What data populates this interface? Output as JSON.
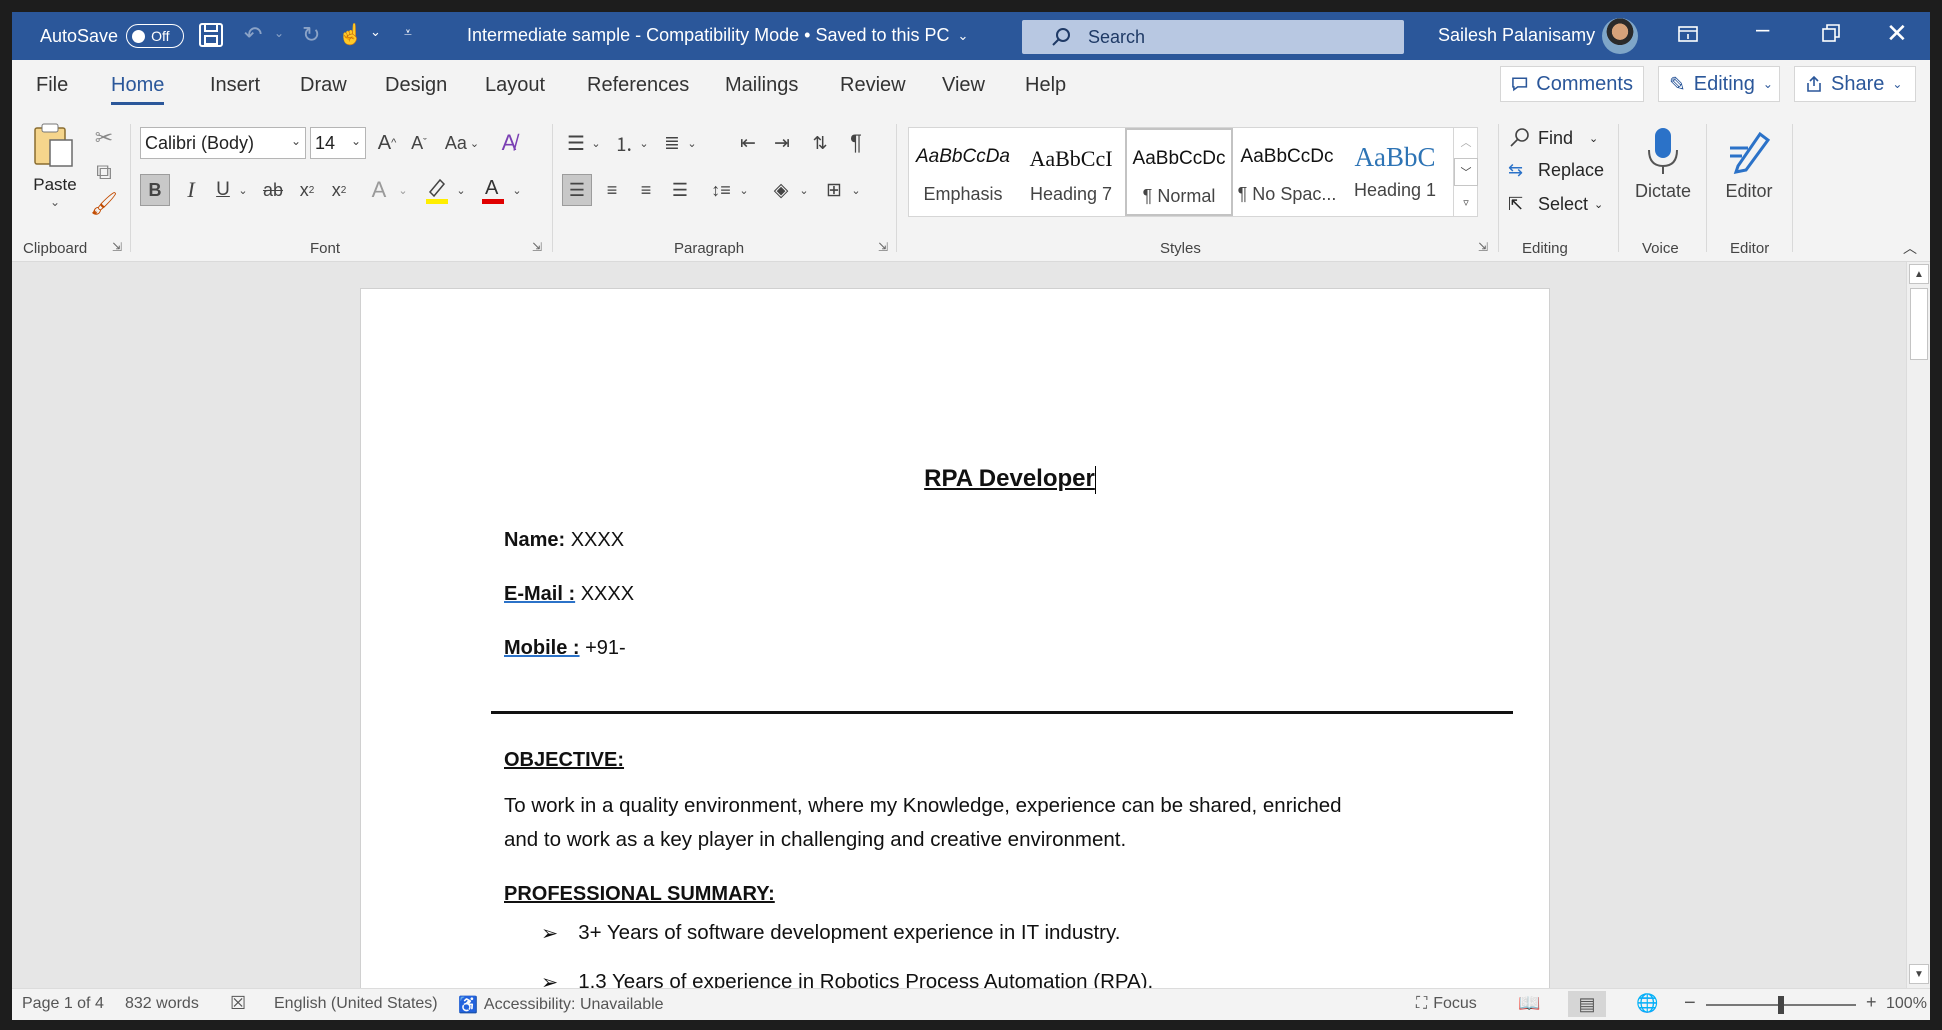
{
  "titlebar": {
    "autosave_label": "AutoSave",
    "autosave_state": "Off",
    "doc_title": "Intermediate sample  -  Compatibility Mode • Saved to this PC",
    "search_placeholder": "Search",
    "user_name": "Sailesh Palanisamy"
  },
  "menu": {
    "tabs": [
      "File",
      "Home",
      "Insert",
      "Draw",
      "Design",
      "Layout",
      "References",
      "Mailings",
      "Review",
      "View",
      "Help"
    ],
    "active_tab": "Home",
    "comments_label": "Comments",
    "editing_label": "Editing",
    "share_label": "Share"
  },
  "ribbon": {
    "clipboard": {
      "paste_label": "Paste",
      "group_label": "Clipboard"
    },
    "font": {
      "font_name": "Calibri (Body)",
      "font_size": "14",
      "case_label": "Aa",
      "group_label": "Font"
    },
    "paragraph": {
      "group_label": "Paragraph"
    },
    "styles": {
      "items": [
        {
          "preview": "AaBbCcDa",
          "name": "Emphasis"
        },
        {
          "preview": "AaBbCcI",
          "name": "Heading 7"
        },
        {
          "preview": "AaBbCcDc",
          "name": "¶ Normal"
        },
        {
          "preview": "AaBbCcDc",
          "name": "¶ No Spac..."
        },
        {
          "preview": "AaBbC",
          "name": "Heading 1"
        }
      ],
      "group_label": "Styles"
    },
    "editing": {
      "find_label": "Find",
      "replace_label": "Replace",
      "select_label": "Select",
      "group_label": "Editing"
    },
    "voice": {
      "dictate_label": "Dictate",
      "group_label": "Voice"
    },
    "editor": {
      "editor_label": "Editor",
      "group_label": "Editor"
    }
  },
  "document": {
    "title": "RPA Developer",
    "fields": [
      {
        "label": "Name:",
        "value": "XXXX"
      },
      {
        "label": "E-Mail :",
        "value": "XXXX"
      },
      {
        "label": "Mobile :",
        "value": "+91-"
      }
    ],
    "objective_heading": "OBJECTIVE:",
    "objective_line1": "To work in a quality environment, where my Knowledge, experience can be shared, enriched",
    "objective_line2": "and to work as a key player in challenging and creative environment.",
    "summary_heading": "PROFESSIONAL SUMMARY:",
    "bullets": [
      "3+ Years of software development experience in IT industry.",
      "1.3 Years of experience in Robotics Process Automation (RPA)."
    ]
  },
  "status": {
    "page": "Page 1 of 4",
    "words": "832 words",
    "language": "English (United States)",
    "accessibility": "Accessibility: Unavailable",
    "focus": "Focus",
    "zoom": "100%",
    "zoom_level": 1.0
  },
  "colors": {
    "accent": "#2b579a",
    "title_bar": "#2b579a"
  }
}
